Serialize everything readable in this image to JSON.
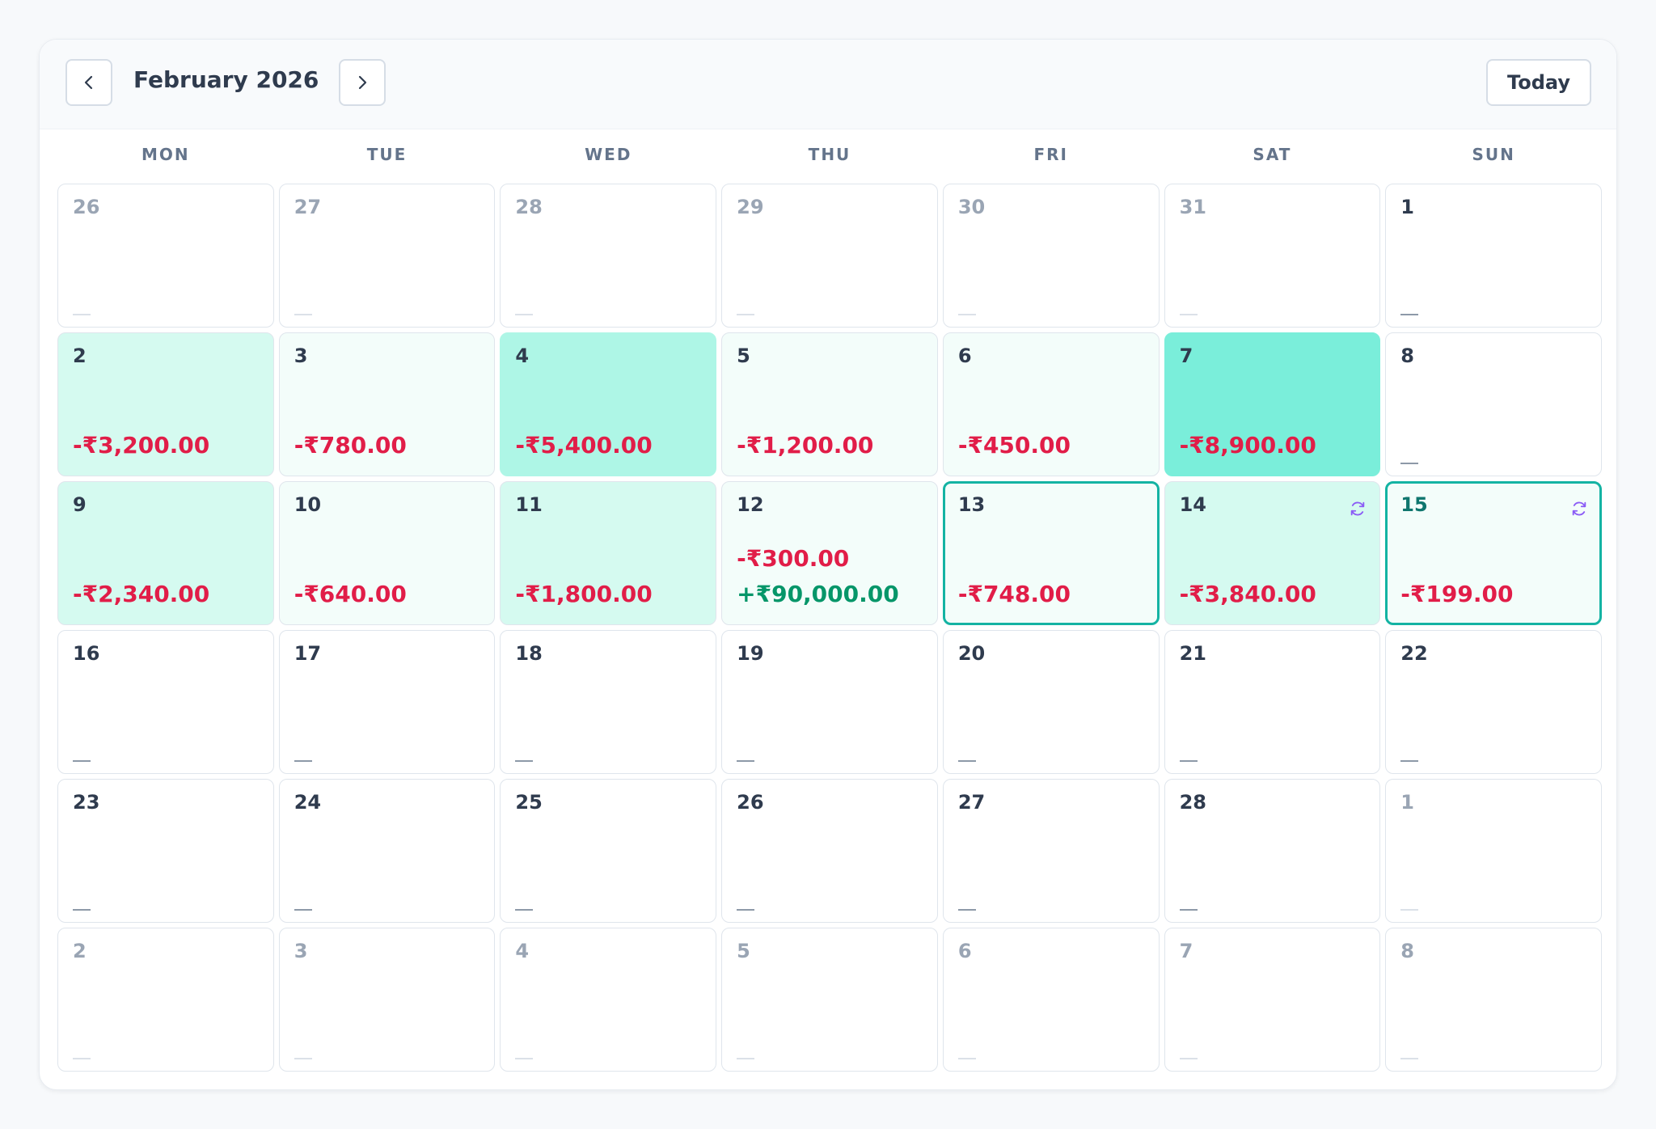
{
  "header": {
    "title": "February 2026",
    "prev_icon": "chevron-left-icon",
    "next_icon": "chevron-right-icon",
    "today_label": "Today"
  },
  "weekdays": [
    "MON",
    "TUE",
    "WED",
    "THU",
    "FRI",
    "SAT",
    "SUN"
  ],
  "colors": {
    "expense": "#e11d48",
    "income": "#059669",
    "selected_border": "#14b3a3",
    "recurring_icon": "#8b5cf6",
    "intensity_levels": [
      "#f3fdfa",
      "#d5faf0",
      "#aef6e6",
      "#7aeeda"
    ]
  },
  "empty_marker": "—",
  "days": [
    {
      "day": "26",
      "month": "prev",
      "amounts": []
    },
    {
      "day": "27",
      "month": "prev",
      "amounts": []
    },
    {
      "day": "28",
      "month": "prev",
      "amounts": []
    },
    {
      "day": "29",
      "month": "prev",
      "amounts": []
    },
    {
      "day": "30",
      "month": "prev",
      "amounts": []
    },
    {
      "day": "31",
      "month": "prev",
      "amounts": []
    },
    {
      "day": "1",
      "month": "current",
      "amounts": []
    },
    {
      "day": "2",
      "month": "current",
      "intensity": 2,
      "amounts": [
        {
          "text": "-₹3,200.00",
          "type": "expense"
        }
      ]
    },
    {
      "day": "3",
      "month": "current",
      "intensity": 1,
      "amounts": [
        {
          "text": "-₹780.00",
          "type": "expense"
        }
      ]
    },
    {
      "day": "4",
      "month": "current",
      "intensity": 3,
      "amounts": [
        {
          "text": "-₹5,400.00",
          "type": "expense"
        }
      ]
    },
    {
      "day": "5",
      "month": "current",
      "intensity": 1,
      "amounts": [
        {
          "text": "-₹1,200.00",
          "type": "expense"
        }
      ]
    },
    {
      "day": "6",
      "month": "current",
      "intensity": 1,
      "amounts": [
        {
          "text": "-₹450.00",
          "type": "expense"
        }
      ]
    },
    {
      "day": "7",
      "month": "current",
      "intensity": 4,
      "amounts": [
        {
          "text": "-₹8,900.00",
          "type": "expense"
        }
      ]
    },
    {
      "day": "8",
      "month": "current",
      "amounts": []
    },
    {
      "day": "9",
      "month": "current",
      "intensity": 2,
      "amounts": [
        {
          "text": "-₹2,340.00",
          "type": "expense"
        }
      ]
    },
    {
      "day": "10",
      "month": "current",
      "intensity": 1,
      "amounts": [
        {
          "text": "-₹640.00",
          "type": "expense"
        }
      ]
    },
    {
      "day": "11",
      "month": "current",
      "intensity": 2,
      "amounts": [
        {
          "text": "-₹1,800.00",
          "type": "expense"
        }
      ]
    },
    {
      "day": "12",
      "month": "current",
      "intensity": 1,
      "amounts": [
        {
          "text": "-₹300.00",
          "type": "expense"
        },
        {
          "text": "+₹90,000.00",
          "type": "income"
        }
      ]
    },
    {
      "day": "13",
      "month": "current",
      "intensity": 1,
      "selected": true,
      "amounts": [
        {
          "text": "-₹748.00",
          "type": "expense"
        }
      ]
    },
    {
      "day": "14",
      "month": "current",
      "intensity": 2,
      "recurring": true,
      "amounts": [
        {
          "text": "-₹3,840.00",
          "type": "expense"
        }
      ]
    },
    {
      "day": "15",
      "month": "current",
      "intensity": 1,
      "selected": true,
      "today": true,
      "recurring": true,
      "amounts": [
        {
          "text": "-₹199.00",
          "type": "expense"
        }
      ]
    },
    {
      "day": "16",
      "month": "current",
      "amounts": []
    },
    {
      "day": "17",
      "month": "current",
      "amounts": []
    },
    {
      "day": "18",
      "month": "current",
      "amounts": []
    },
    {
      "day": "19",
      "month": "current",
      "amounts": []
    },
    {
      "day": "20",
      "month": "current",
      "amounts": []
    },
    {
      "day": "21",
      "month": "current",
      "amounts": []
    },
    {
      "day": "22",
      "month": "current",
      "amounts": []
    },
    {
      "day": "23",
      "month": "current",
      "amounts": []
    },
    {
      "day": "24",
      "month": "current",
      "amounts": []
    },
    {
      "day": "25",
      "month": "current",
      "amounts": []
    },
    {
      "day": "26",
      "month": "current",
      "amounts": []
    },
    {
      "day": "27",
      "month": "current",
      "amounts": []
    },
    {
      "day": "28",
      "month": "current",
      "amounts": []
    },
    {
      "day": "1",
      "month": "next",
      "amounts": []
    },
    {
      "day": "2",
      "month": "next",
      "amounts": []
    },
    {
      "day": "3",
      "month": "next",
      "amounts": []
    },
    {
      "day": "4",
      "month": "next",
      "amounts": []
    },
    {
      "day": "5",
      "month": "next",
      "amounts": []
    },
    {
      "day": "6",
      "month": "next",
      "amounts": []
    },
    {
      "day": "7",
      "month": "next",
      "amounts": []
    },
    {
      "day": "8",
      "month": "next",
      "amounts": []
    }
  ]
}
